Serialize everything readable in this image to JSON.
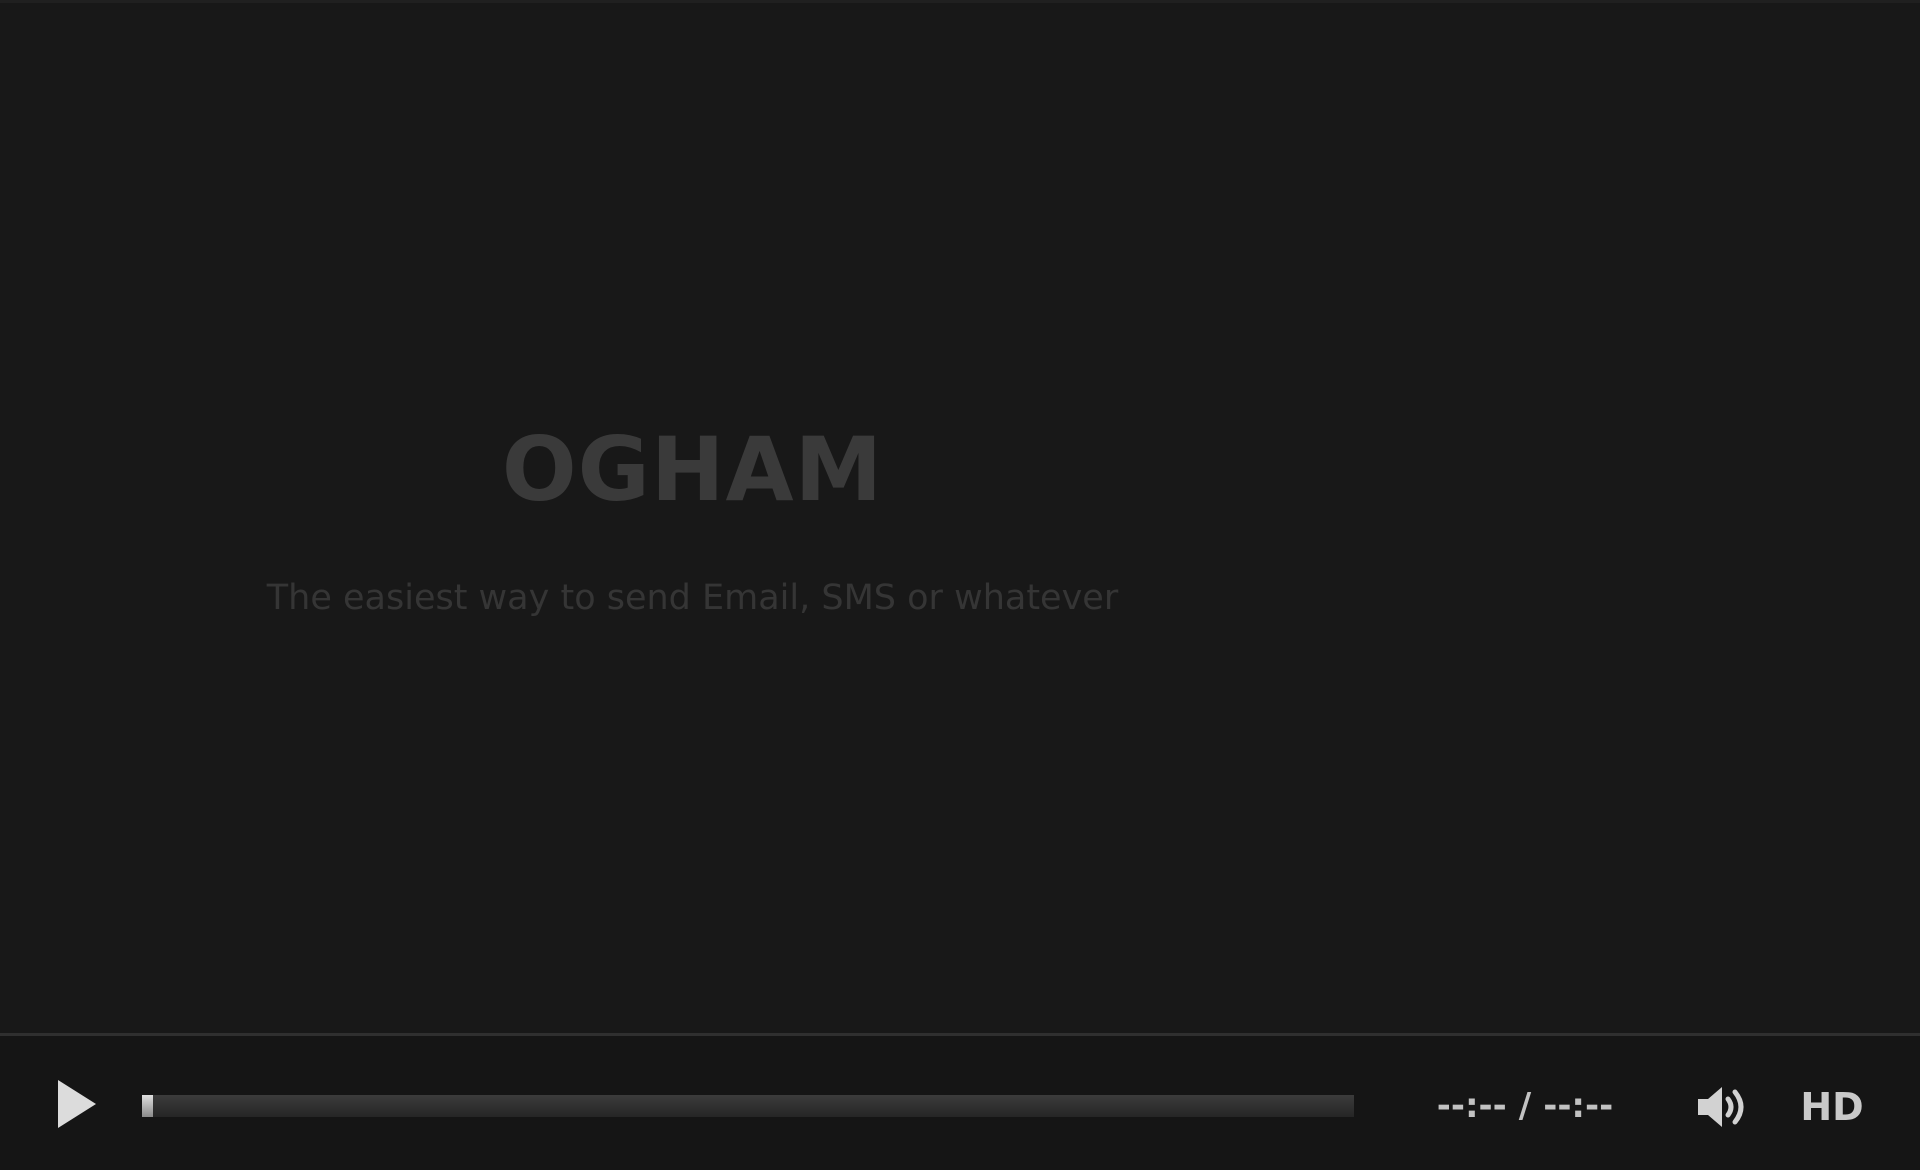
{
  "stage": {
    "title": "OGHAM",
    "subtitle": "The easiest way to send Email, SMS or whatever"
  },
  "controls": {
    "play_icon": "play-icon",
    "progress": 0.009,
    "current_time": "--:--",
    "separator": "/",
    "duration": "--:--",
    "volume_icon": "volume-icon",
    "hd_label": "HD"
  },
  "colors": {
    "background": "#181818",
    "controls_background": "#151515",
    "control_foreground": "#c9c9c9"
  }
}
